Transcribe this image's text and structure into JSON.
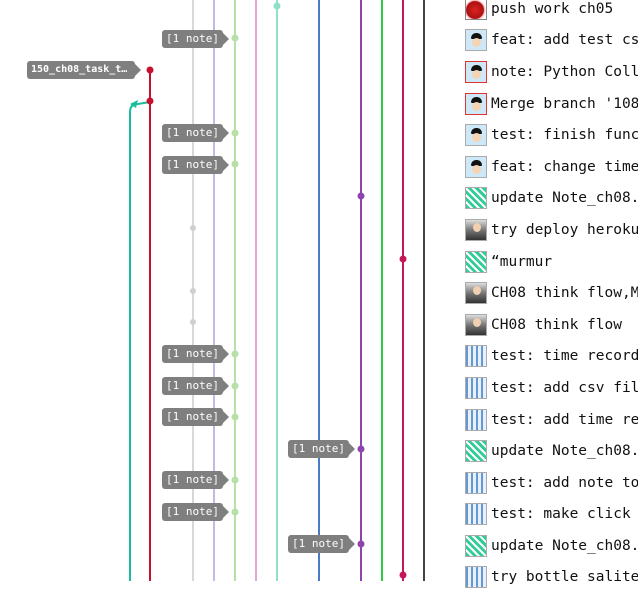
{
  "branch_tag": "150_ch08_task_t…",
  "note_tag": "[1 note]",
  "colors": {
    "tag_bg": "#7f7f7f",
    "red": "#c8102e",
    "teal": "#1abc9c",
    "purple": "#8e44ad",
    "blue": "#4a7bc8",
    "green": "#2ecc40",
    "crimson": "#c2185b"
  },
  "commits": [
    {
      "message": "push work ch05",
      "avatar": "apple-icon"
    },
    {
      "message": "feat: add test cs",
      "avatar": "face-icon"
    },
    {
      "message": "note: Python Coll",
      "avatar": "face-icon"
    },
    {
      "message": "Merge branch '108",
      "avatar": "face-icon"
    },
    {
      "message": "test: finish func",
      "avatar": "face-icon"
    },
    {
      "message": "feat: change time",
      "avatar": "face-icon"
    },
    {
      "message": "update Note_ch08.",
      "avatar": "pattern-icon"
    },
    {
      "message": "try deploy heroku",
      "avatar": "photo-icon"
    },
    {
      "message": "“murmur",
      "avatar": "pattern-icon"
    },
    {
      "message": "CH08 think flow,M",
      "avatar": "photo-icon"
    },
    {
      "message": "CH08 think flow",
      "avatar": "photo-icon"
    },
    {
      "message": "test: time record",
      "avatar": "pattern-icon"
    },
    {
      "message": "test: add csv fil",
      "avatar": "pattern-icon"
    },
    {
      "message": "test: add time re",
      "avatar": "pattern-icon"
    },
    {
      "message": "update Note_ch08.",
      "avatar": "pattern-icon"
    },
    {
      "message": "test: add note to",
      "avatar": "pattern-icon"
    },
    {
      "message": "test: make click",
      "avatar": "pattern-icon"
    },
    {
      "message": "update Note_ch08.",
      "avatar": "pattern-icon"
    },
    {
      "message": "try bottle salite",
      "avatar": "pattern-icon"
    }
  ]
}
